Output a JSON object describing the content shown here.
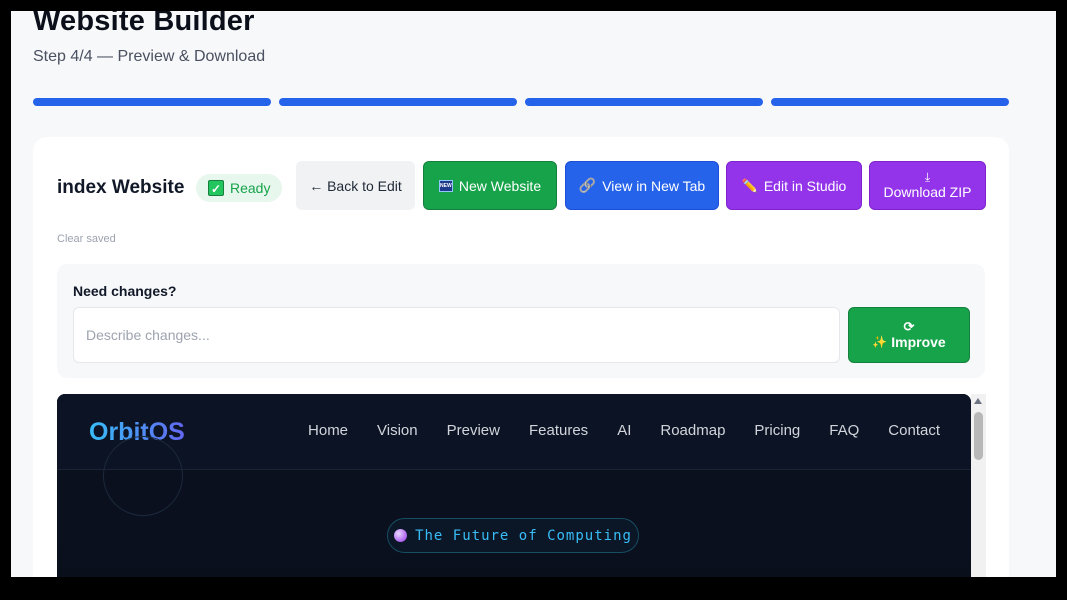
{
  "header": {
    "title": "Website Builder",
    "subtitle": "Step 4/4 — Preview & Download",
    "progress_steps": 4,
    "progress_completed": 4
  },
  "site": {
    "name": "index Website",
    "status": "Ready"
  },
  "actions": {
    "back": "← Back to Edit",
    "new_website": "New Website",
    "view_tab": "View in New Tab",
    "edit_studio": "Edit in Studio",
    "download_zip": "Download ZIP"
  },
  "clear_saved": "Clear saved",
  "changes": {
    "label": "Need changes?",
    "placeholder": "Describe changes...",
    "value": "",
    "improve_label": "Improve"
  },
  "preview": {
    "brand": "OrbitOS",
    "nav": [
      "Home",
      "Vision",
      "Preview",
      "Features",
      "AI",
      "Roadmap",
      "Pricing",
      "FAQ",
      "Contact"
    ],
    "badge": "The Future of Computing"
  },
  "colors": {
    "accent_blue": "#2563eb",
    "green": "#16a34a",
    "purple": "#9333ea",
    "preview_bg": "#0b1120"
  }
}
